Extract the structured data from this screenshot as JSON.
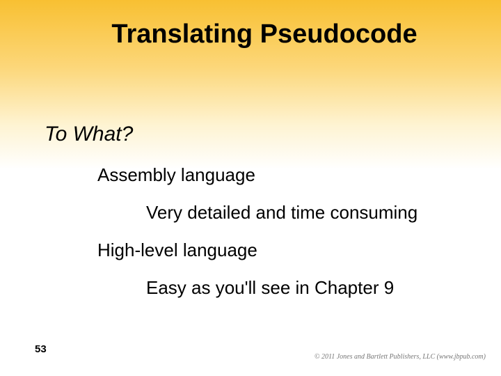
{
  "title": "Translating Pseudocode",
  "subtitle": "To What?",
  "body": {
    "line1": "Assembly language",
    "line2": "Very detailed and time consuming",
    "line3": "High-level language",
    "line4": "Easy as you'll see in Chapter 9"
  },
  "page_number": "53",
  "copyright": "© 2011 Jones and Bartlett Publishers, LLC (www.jbpub.com)"
}
